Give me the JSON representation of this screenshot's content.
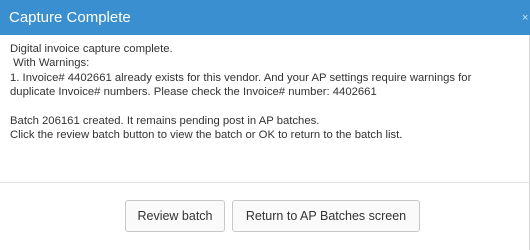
{
  "dialog": {
    "title": "Capture Complete",
    "close_label": "×",
    "messages": {
      "line1": "Digital invoice capture complete.",
      "line2": " With Warnings:",
      "line3": "1. Invoice# 4402661 already exists for this vendor. And your AP settings require warnings for",
      "line4": "duplicate Invoice# numbers. Please check the Invoice# number: 4402661",
      "line5": "Batch 206161 created. It remains pending post in AP batches.",
      "line6": "Click the review batch button to view the batch or OK to return to the batch list."
    },
    "buttons": {
      "review": "Review batch",
      "return": "Return to AP Batches screen"
    }
  }
}
